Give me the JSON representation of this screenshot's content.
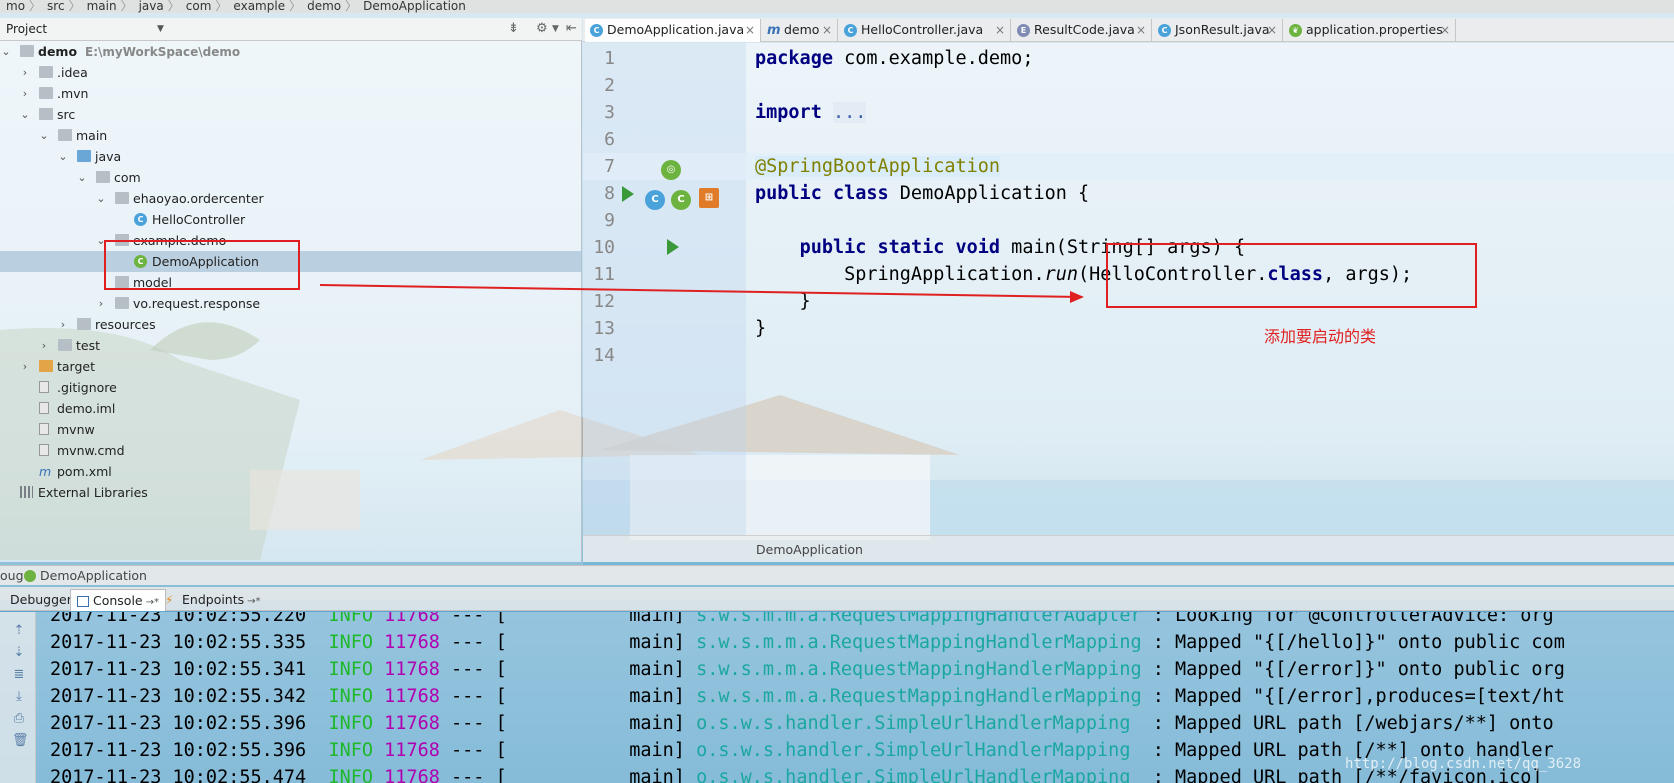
{
  "breadcrumb": [
    "mo",
    "src",
    "main",
    "java",
    "com",
    "example",
    "demo",
    "DemoApplication"
  ],
  "project_panel": {
    "title": "Project",
    "tree": [
      {
        "label": "demo",
        "hint": "E:\\myWorkSpace\\demo",
        "bold": true,
        "depth": 0,
        "arrow": "open",
        "icon": "folder"
      },
      {
        "label": ".idea",
        "depth": 1,
        "arrow": "closed",
        "icon": "folder"
      },
      {
        "label": ".mvn",
        "depth": 1,
        "arrow": "closed",
        "icon": "folder"
      },
      {
        "label": "src",
        "depth": 1,
        "arrow": "open",
        "icon": "folder"
      },
      {
        "label": "main",
        "depth": 2,
        "arrow": "open",
        "icon": "folder"
      },
      {
        "label": "java",
        "depth": 3,
        "arrow": "open",
        "icon": "folder-blue"
      },
      {
        "label": "com",
        "depth": 4,
        "arrow": "open",
        "icon": "package"
      },
      {
        "label": "ehaoyao.ordercenter",
        "depth": 5,
        "arrow": "open",
        "icon": "package"
      },
      {
        "label": "HelloController",
        "depth": 6,
        "arrow": "",
        "icon": "class"
      },
      {
        "label": "example.demo",
        "depth": 5,
        "arrow": "open",
        "icon": "package"
      },
      {
        "label": "DemoApplication",
        "depth": 6,
        "arrow": "",
        "icon": "spring-class",
        "selected": true
      },
      {
        "label": "model",
        "depth": 5,
        "arrow": "",
        "icon": "package"
      },
      {
        "label": "vo.request.response",
        "depth": 5,
        "arrow": "closed",
        "icon": "package"
      },
      {
        "label": "resources",
        "depth": 3,
        "arrow": "closed",
        "icon": "folder"
      },
      {
        "label": "test",
        "depth": 2,
        "arrow": "closed",
        "icon": "folder"
      },
      {
        "label": "target",
        "depth": 1,
        "arrow": "closed",
        "icon": "folder-orange"
      },
      {
        "label": ".gitignore",
        "depth": 1,
        "arrow": "",
        "icon": "file"
      },
      {
        "label": "demo.iml",
        "depth": 1,
        "arrow": "",
        "icon": "file"
      },
      {
        "label": "mvnw",
        "depth": 1,
        "arrow": "",
        "icon": "file"
      },
      {
        "label": "mvnw.cmd",
        "depth": 1,
        "arrow": "",
        "icon": "file"
      },
      {
        "label": "pom.xml",
        "depth": 1,
        "arrow": "",
        "icon": "maven"
      },
      {
        "label": "External Libraries",
        "depth": 0,
        "arrow": "",
        "icon": "library"
      }
    ]
  },
  "editor": {
    "tabs": [
      {
        "label": "DemoApplication.java",
        "icon": "spring-class",
        "active": true
      },
      {
        "label": "demo",
        "icon": "maven"
      },
      {
        "label": "HelloController.java",
        "icon": "class"
      },
      {
        "label": "ResultCode.java",
        "icon": "enum"
      },
      {
        "label": "JsonResult.java",
        "icon": "class"
      },
      {
        "label": "application.properties",
        "icon": "spring"
      }
    ],
    "lines": [
      {
        "n": "1",
        "code": [
          [
            "kw",
            "package"
          ],
          [
            "",
            " com.example.demo;"
          ]
        ]
      },
      {
        "n": "2",
        "code": []
      },
      {
        "n": "3",
        "code": [
          [
            "kw",
            "import"
          ],
          [
            "",
            " "
          ],
          [
            "fold",
            "..."
          ]
        ]
      },
      {
        "n": "6",
        "code": []
      },
      {
        "n": "7",
        "code": [
          [
            "ann",
            "@SpringBootApplication"
          ]
        ],
        "highlight": true
      },
      {
        "n": "8",
        "code": [
          [
            "kw",
            "public class"
          ],
          [
            "",
            " DemoApplication {"
          ]
        ]
      },
      {
        "n": "9",
        "code": []
      },
      {
        "n": "10",
        "code": [
          [
            "",
            "    "
          ],
          [
            "kw",
            "public static void"
          ],
          [
            "",
            " main(String[] args) {"
          ]
        ]
      },
      {
        "n": "11",
        "code": [
          [
            "",
            "        SpringApplication."
          ],
          [
            "ital",
            "run"
          ],
          [
            "",
            "(HelloController."
          ],
          [
            "kw",
            "class"
          ],
          [
            "",
            ", args);"
          ]
        ]
      },
      {
        "n": "12",
        "code": [
          [
            "",
            "    }"
          ]
        ]
      },
      {
        "n": "13",
        "code": [
          [
            "",
            "}"
          ]
        ]
      },
      {
        "n": "14",
        "code": []
      }
    ],
    "footer": "DemoApplication"
  },
  "annotation": {
    "note": "添加要启动的类",
    "color": "#e02020"
  },
  "debug": {
    "title_prefix": "oug",
    "title": "DemoApplication",
    "tabs": [
      "Debugger",
      "Console",
      "Endpoints"
    ],
    "logs": [
      {
        "ts": "2017-11-23 10:02:55.220",
        "level": "INFO",
        "pid": "11768",
        "sep": " --- [",
        "thread": "main]",
        "cls": "s.w.s.m.m.a.RequestMappingHandlerAdapter ",
        "msg": ": Looking for @ControllerAdvice: org"
      },
      {
        "ts": "2017-11-23 10:02:55.335",
        "level": "INFO",
        "pid": "11768",
        "sep": " --- [",
        "thread": "main]",
        "cls": "s.w.s.m.m.a.RequestMappingHandlerMapping ",
        "msg": ": Mapped \"{[/hello]}\" onto public com"
      },
      {
        "ts": "2017-11-23 10:02:55.341",
        "level": "INFO",
        "pid": "11768",
        "sep": " --- [",
        "thread": "main]",
        "cls": "s.w.s.m.m.a.RequestMappingHandlerMapping ",
        "msg": ": Mapped \"{[/error]}\" onto public org"
      },
      {
        "ts": "2017-11-23 10:02:55.342",
        "level": "INFO",
        "pid": "11768",
        "sep": " --- [",
        "thread": "main]",
        "cls": "s.w.s.m.m.a.RequestMappingHandlerMapping ",
        "msg": ": Mapped \"{[/error],produces=[text/ht"
      },
      {
        "ts": "2017-11-23 10:02:55.396",
        "level": "INFO",
        "pid": "11768",
        "sep": " --- [",
        "thread": "main]",
        "cls": "o.s.w.s.handler.SimpleUrlHandlerMapping  ",
        "msg": ": Mapped URL path [/webjars/**] onto"
      },
      {
        "ts": "2017-11-23 10:02:55.396",
        "level": "INFO",
        "pid": "11768",
        "sep": " --- [",
        "thread": "main]",
        "cls": "o.s.w.s.handler.SimpleUrlHandlerMapping  ",
        "msg": ": Mapped URL path [/**] onto handler"
      },
      {
        "ts": "2017-11-23 10:02:55.474",
        "level": "INFO",
        "pid": "11768",
        "sep": " --- [",
        "thread": "main]",
        "cls": "o.s.w.s.handler.SimpleUrlHandlerMapping  ",
        "msg": ": Mapped URL path [/**/favicon.ico]"
      }
    ],
    "watermark": "http://blog.csdn.net/qq_3628"
  },
  "colors": {
    "keyword": "#000080",
    "annotation": "#808000",
    "info": "#1fb82a",
    "pid": "#b000b0",
    "logger": "#1aa7a0"
  }
}
